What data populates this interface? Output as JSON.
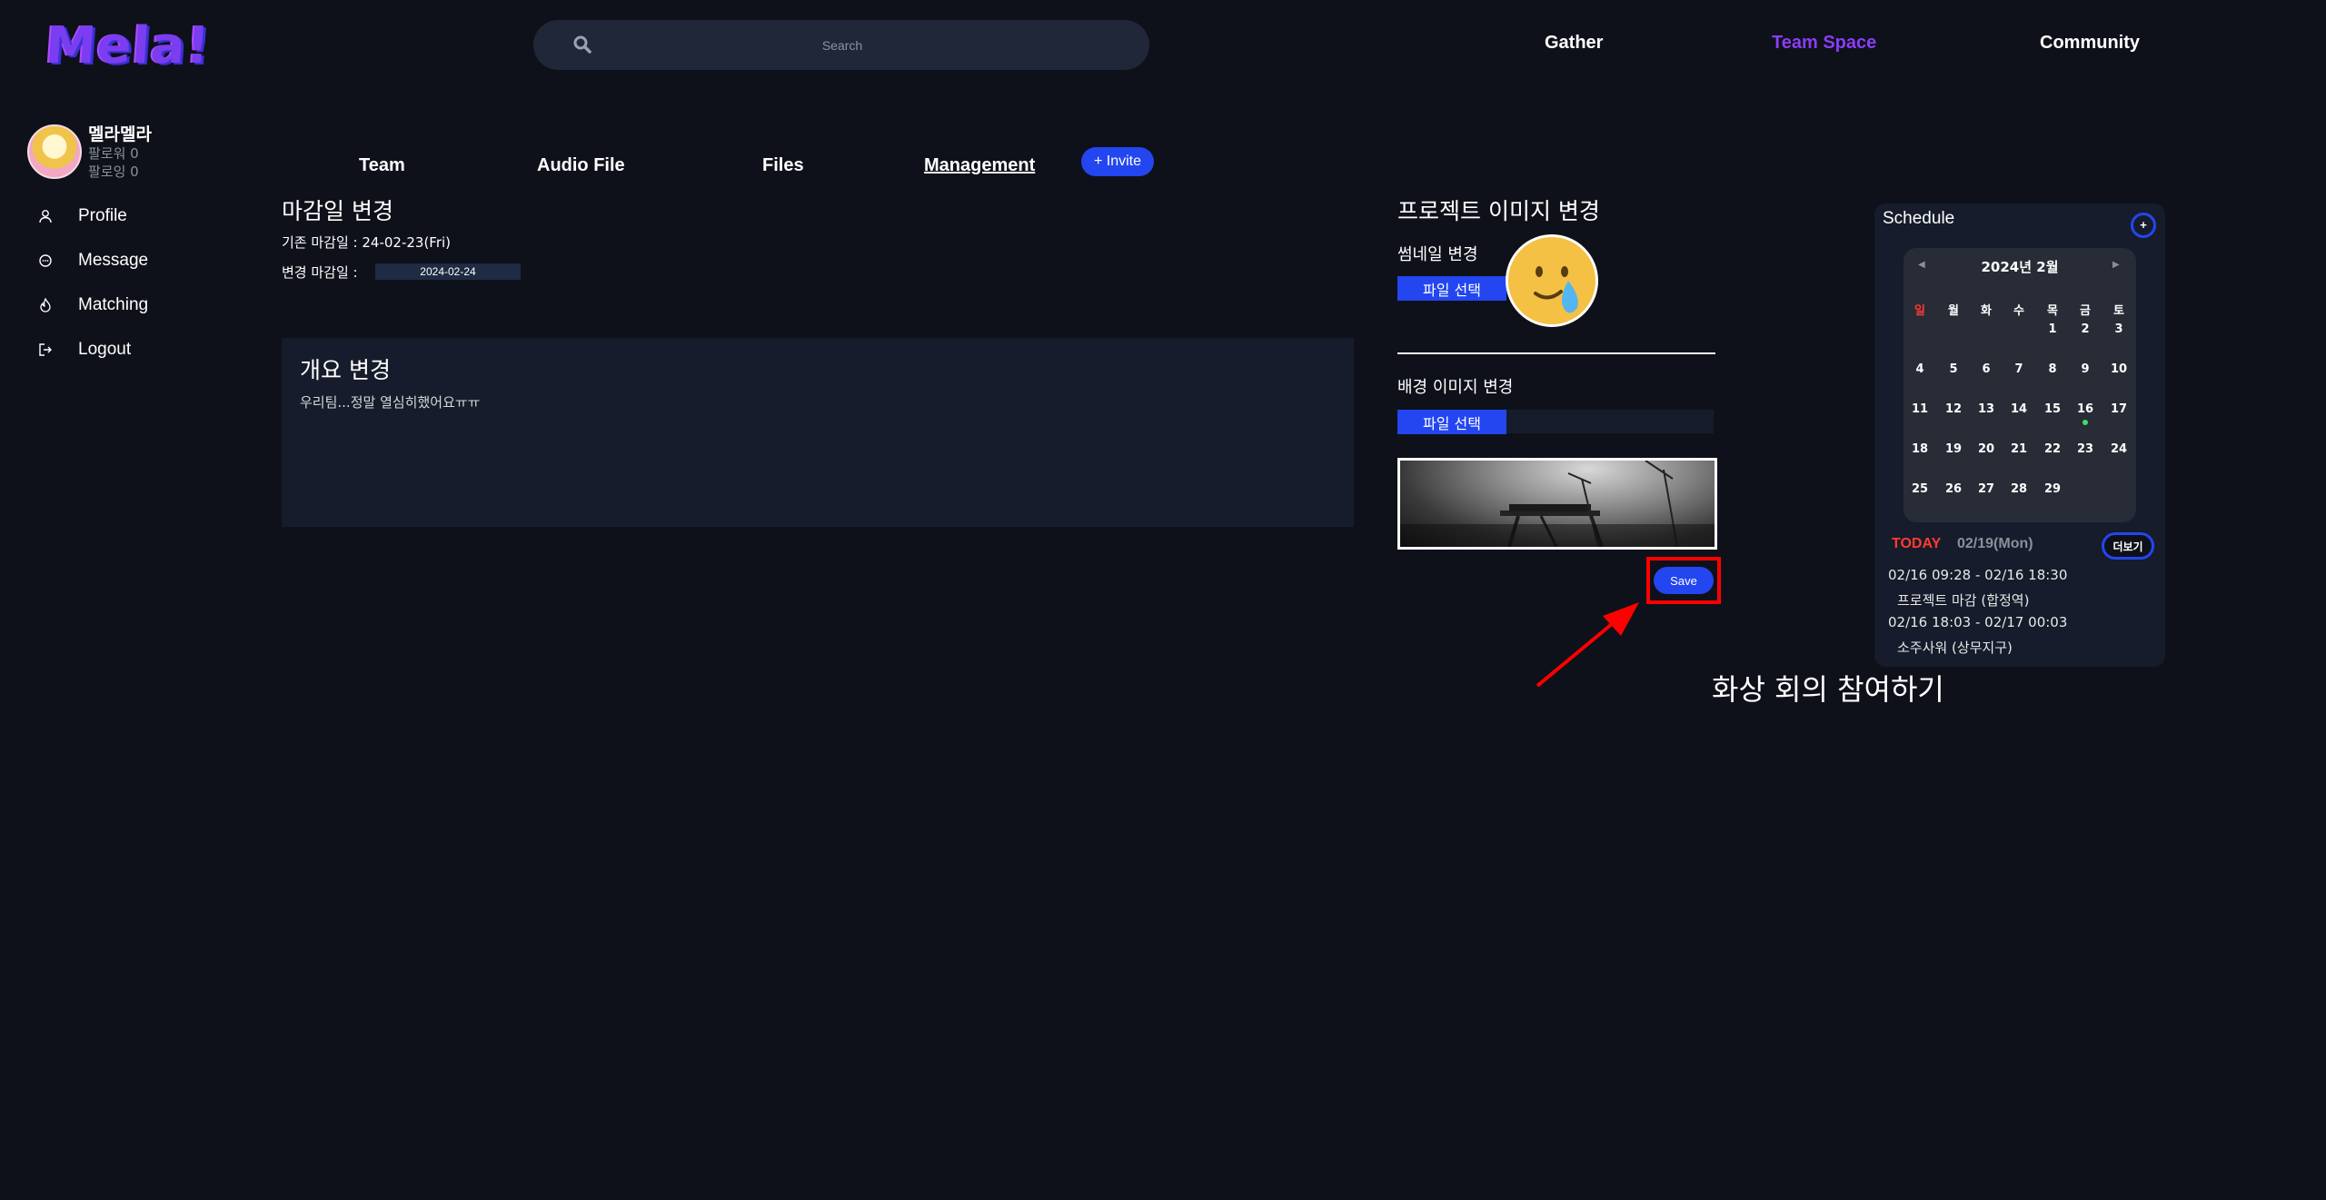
{
  "header": {
    "logo": "Mela!",
    "search_placeholder": "Search",
    "nav": [
      "Gather",
      "Team Space",
      "Community"
    ],
    "active_nav_color": "#8a3df5"
  },
  "user": {
    "name": "멜라멜라",
    "followers": "팔로워 0",
    "following": "팔로잉 0"
  },
  "sidebar": {
    "items": [
      {
        "label": "Profile",
        "icon": "user-icon"
      },
      {
        "label": "Message",
        "icon": "chat-icon"
      },
      {
        "label": "Matching",
        "icon": "fire-icon"
      },
      {
        "label": "Logout",
        "icon": "logout-icon"
      }
    ]
  },
  "tabs": {
    "items": [
      "Team",
      "Audio File",
      "Files",
      "Management"
    ],
    "active": "Management",
    "invite": "+ Invite"
  },
  "deadline": {
    "title": "마감일 변경",
    "current": "기존 마감일 : 24-02-23(Fri)",
    "new_label": "변경 마감일 :",
    "new_value": "2024-02-24"
  },
  "summary": {
    "title": "개요 변경",
    "text": "우리팀...정말 열심히했어요ㅠㅠ"
  },
  "project_image": {
    "title": "프로젝트 이미지 변경",
    "thumbnail_label": "썸네일 변경",
    "file_button": "파일 선택",
    "background_label": "배경 이미지 변경",
    "bg_file_button": "파일 선택",
    "save": "Save"
  },
  "annotation": "화상 회의 참여하기",
  "schedule": {
    "title": "Schedule",
    "add": "+",
    "month": "2024년 2월",
    "prev": "◀",
    "next": "▶",
    "weekdays": [
      "일",
      "월",
      "화",
      "수",
      "목",
      "금",
      "토"
    ],
    "days": [
      "1",
      "2",
      "3",
      "4",
      "5",
      "6",
      "7",
      "8",
      "9",
      "10",
      "11",
      "12",
      "13",
      "14",
      "15",
      "16",
      "17",
      "18",
      "19",
      "20",
      "21",
      "22",
      "23",
      "24",
      "25",
      "26",
      "27",
      "28",
      "29"
    ],
    "first_weekday_index": 4,
    "event_marker_day": "16",
    "today_label": "TODAY",
    "today_date": "02/19(Mon)",
    "more": "더보기",
    "events": [
      {
        "time": "02/16 09:28 - 02/16 18:30",
        "title": "프로젝트 마감 (합정역)"
      },
      {
        "time": "02/16 18:03 - 02/17 00:03",
        "title": "소주사워 (상무지구)"
      }
    ]
  }
}
